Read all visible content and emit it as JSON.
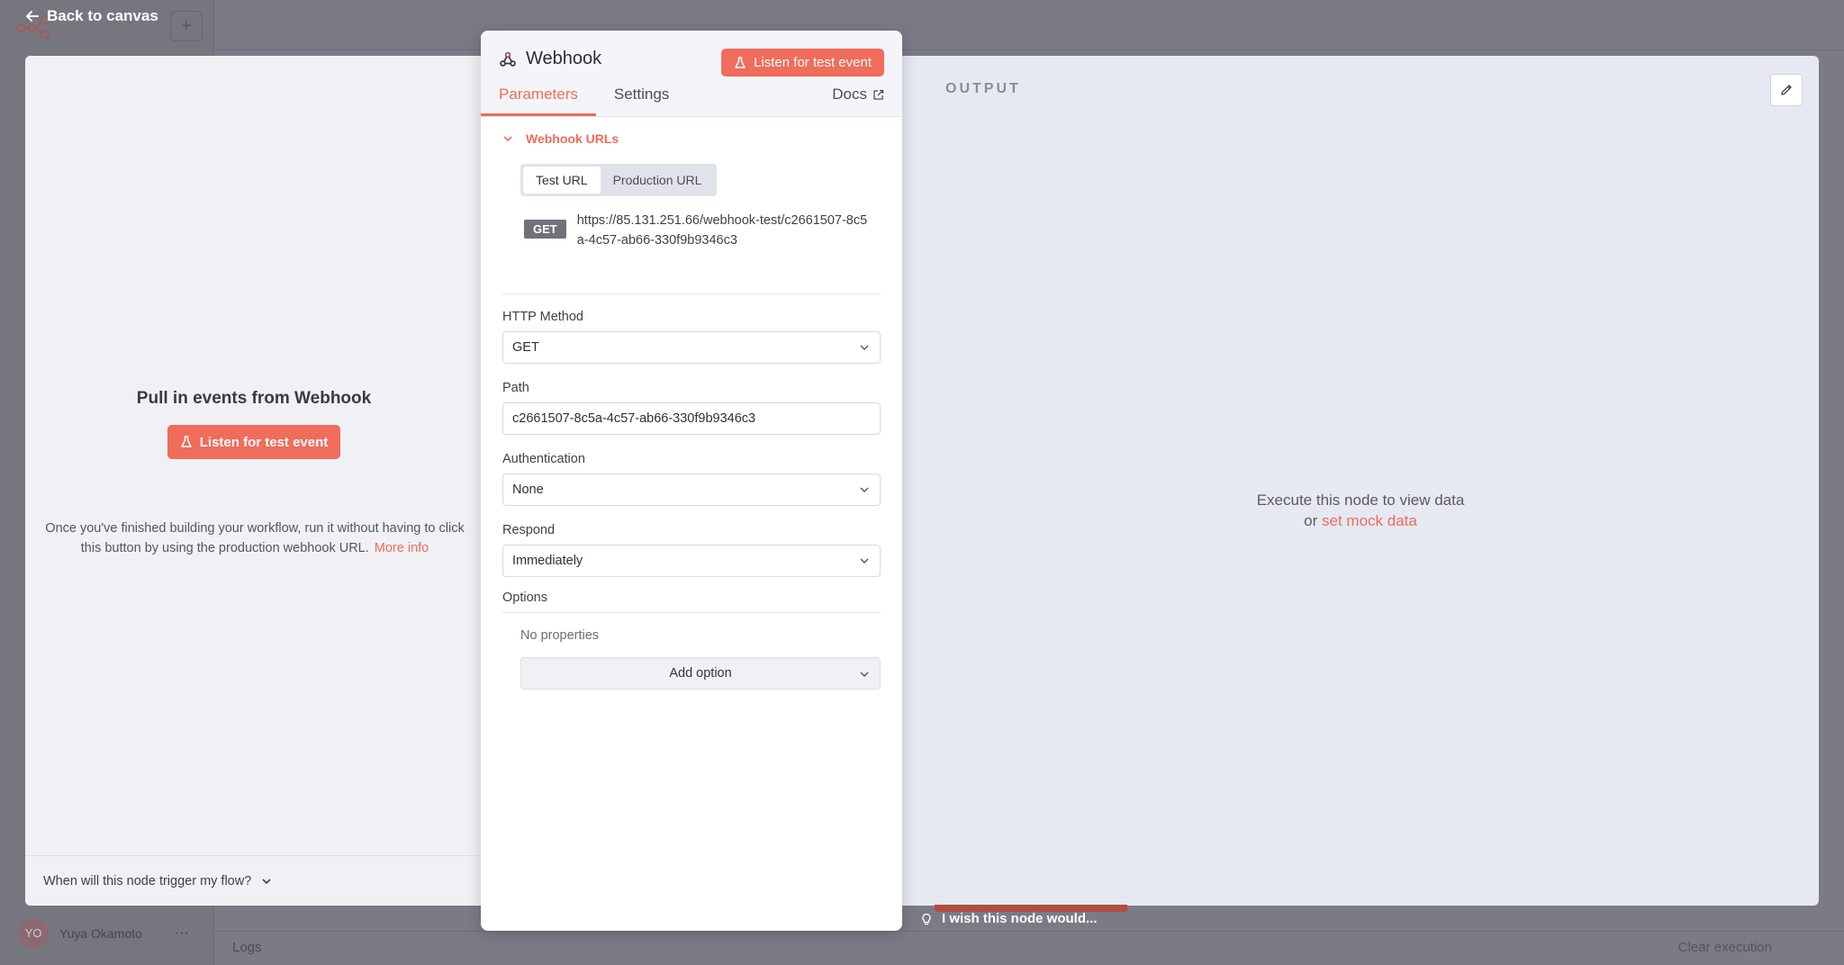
{
  "background": {
    "user_initials": "YO",
    "user_name": "Yuya Okamoto",
    "more": "···",
    "plus": "+",
    "logs_label": "Logs",
    "clear_execution": "Clear execution"
  },
  "back_to_canvas": "Back to canvas",
  "input_panel": {
    "title": "Pull in events from Webhook",
    "listen_button": "Listen for test event",
    "hint": "Once you've finished building your workflow, run it without having to click this button by using the production webhook URL.",
    "more_info": "More info",
    "footer": "When will this node trigger my flow?"
  },
  "node": {
    "name": "Webhook",
    "listen_button": "Listen for test event",
    "tabs": [
      "Parameters",
      "Settings"
    ],
    "docs": "Docs",
    "section_title": "Webhook URLs",
    "url_options": [
      "Test URL",
      "Production URL"
    ],
    "method_badge": "GET",
    "url": "https://85.131.251.66/webhook-test/c2661507-8c5a-4c57-ab66-330f9b9346c3",
    "fields": {
      "http_method": {
        "label": "HTTP Method",
        "value": "GET"
      },
      "path": {
        "label": "Path",
        "value": "c2661507-8c5a-4c57-ab66-330f9b9346c3"
      },
      "authentication": {
        "label": "Authentication",
        "value": "None"
      },
      "respond": {
        "label": "Respond",
        "value": "Immediately"
      }
    },
    "options_label": "Options",
    "no_properties": "No properties",
    "add_option": "Add option"
  },
  "output_panel": {
    "title": "OUTPUT",
    "empty_line1": "Execute this node to view data",
    "empty_or": "or",
    "mock_link": "set mock data"
  },
  "feedback": "I wish this node would...",
  "colors": {
    "accent": "#f06c5b",
    "overlay": "#7b7b86",
    "badge": "#71717a"
  }
}
